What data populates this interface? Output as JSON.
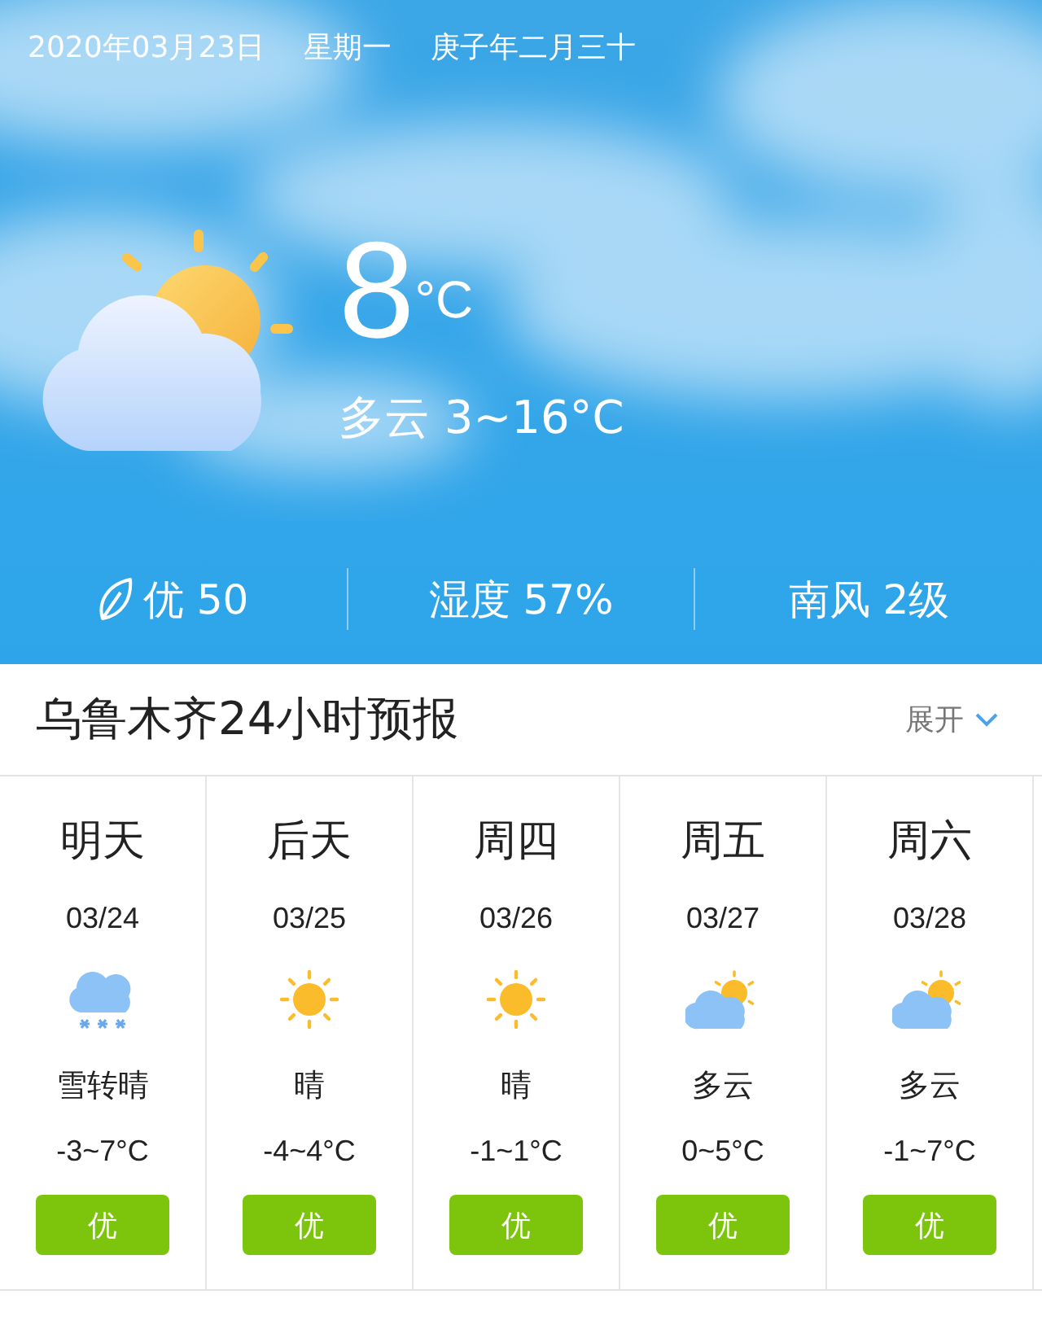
{
  "header": {
    "date": "2020年03月23日",
    "weekday": "星期一",
    "lunar": "庚子年二月三十"
  },
  "current": {
    "kind": "partly_cloudy",
    "temperature": "8",
    "unit": "°C",
    "summary": "多云 3~16°C"
  },
  "stats": [
    {
      "kind": "air",
      "text": "优 50"
    },
    {
      "kind": "plain",
      "text": "湿度 57%"
    },
    {
      "kind": "plain",
      "text": "南风 2级"
    }
  ],
  "forecast_section": {
    "title": "乌鲁木齐24小时预报",
    "toggle": "展开",
    "expanded": false
  },
  "forecast": [
    {
      "day": "明天",
      "date": "03/24",
      "kind": "snow",
      "condition": "雪转晴",
      "temp": "-3~7°C",
      "air": "优"
    },
    {
      "day": "后天",
      "date": "03/25",
      "kind": "sunny",
      "condition": "晴",
      "temp": "-4~4°C",
      "air": "优"
    },
    {
      "day": "周四",
      "date": "03/26",
      "kind": "sunny",
      "condition": "晴",
      "temp": "-1~1°C",
      "air": "优"
    },
    {
      "day": "周五",
      "date": "03/27",
      "kind": "partly_cloudy",
      "condition": "多云",
      "temp": "0~5°C",
      "air": "优"
    },
    {
      "day": "周六",
      "date": "03/28",
      "kind": "partly_cloudy",
      "condition": "多云",
      "temp": "-1~7°C",
      "air": "优"
    }
  ]
}
